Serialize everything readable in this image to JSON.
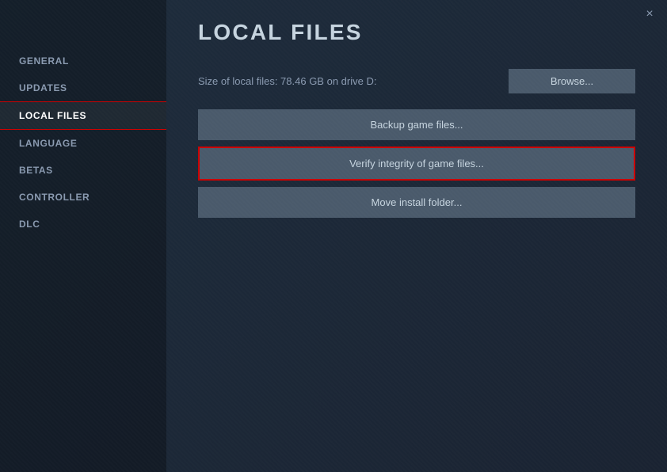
{
  "window": {
    "title": "LOCAL FILES"
  },
  "close_button": "×",
  "sidebar": {
    "items": [
      {
        "id": "general",
        "label": "GENERAL",
        "active": false
      },
      {
        "id": "updates",
        "label": "UPDATES",
        "active": false
      },
      {
        "id": "local-files",
        "label": "LOCAL FILES",
        "active": true
      },
      {
        "id": "language",
        "label": "LANGUAGE",
        "active": false
      },
      {
        "id": "betas",
        "label": "BETAS",
        "active": false
      },
      {
        "id": "controller",
        "label": "CONTROLLER",
        "active": false
      },
      {
        "id": "dlc",
        "label": "DLC",
        "active": false
      }
    ]
  },
  "main": {
    "page_title": "LOCAL FILES",
    "info_text": "Size of local files: 78.46 GB on drive D:",
    "browse_label": "Browse...",
    "buttons": [
      {
        "id": "backup",
        "label": "Backup game files...",
        "highlighted": false
      },
      {
        "id": "verify",
        "label": "Verify integrity of game files...",
        "highlighted": true
      },
      {
        "id": "move",
        "label": "Move install folder...",
        "highlighted": false
      }
    ]
  }
}
